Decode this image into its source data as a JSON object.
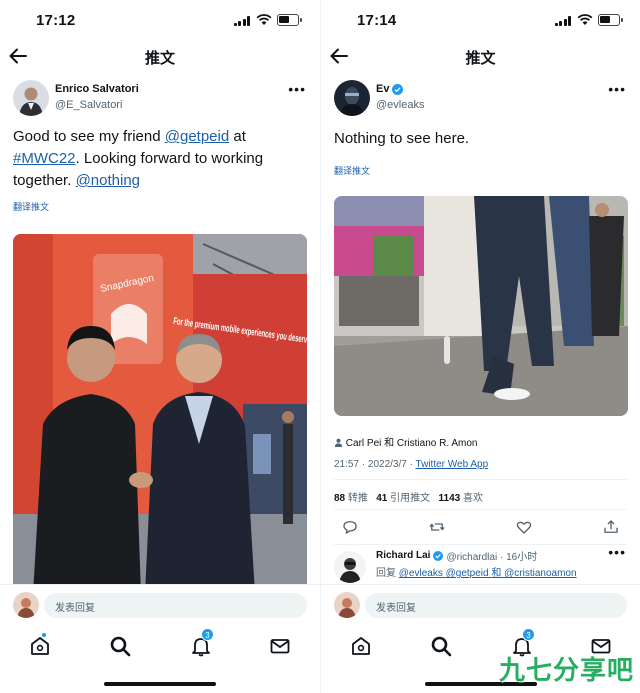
{
  "left": {
    "status_time": "17:12",
    "nav_title": "推文",
    "author": {
      "name": "Enrico Salvatori",
      "handle": "@E_Salvatori"
    },
    "text": {
      "p1": "Good to see my friend ",
      "m1": "@getpeid",
      "p2": " at ",
      "m2": "#MWC22",
      "p3": ". Looking forward to working together. ",
      "m3": "@nothing"
    },
    "translate": "翻译推文",
    "photo_sign_1": "Snapdragon",
    "photo_sign_2": "For the premium mobile experiences you deserve.",
    "compose_placeholder": "发表回复",
    "notif_badge": "3"
  },
  "right": {
    "status_time": "17:14",
    "nav_title": "推文",
    "author": {
      "name": "Ev",
      "handle": "@evleaks",
      "verified": true
    },
    "text": "Nothing to see here.",
    "translate": "翻译推文",
    "tagged": "Carl Pei 和 Cristiano R. Amon",
    "timestamp": "21:57 · 2022/3/7 · ",
    "source": "Twitter Web App",
    "stats": {
      "retweets_count": "88",
      "retweets_label": "转推",
      "quotes_count": "41",
      "quotes_label": "引用推文",
      "likes_count": "1143",
      "likes_label": "喜欢"
    },
    "reply": {
      "name": "Richard Lai",
      "handle_time": "@richardlai · 16小时",
      "prefix": "回复 ",
      "mentions": "@evleaks @getpeid 和 @cristianoamon"
    },
    "compose_placeholder": "发表回复",
    "notif_badge": "3"
  },
  "watermark": "九七分享吧",
  "colors": {
    "link": "#1d5fa8",
    "accent": "#1d9bf0",
    "watermark": "#27ae60"
  }
}
